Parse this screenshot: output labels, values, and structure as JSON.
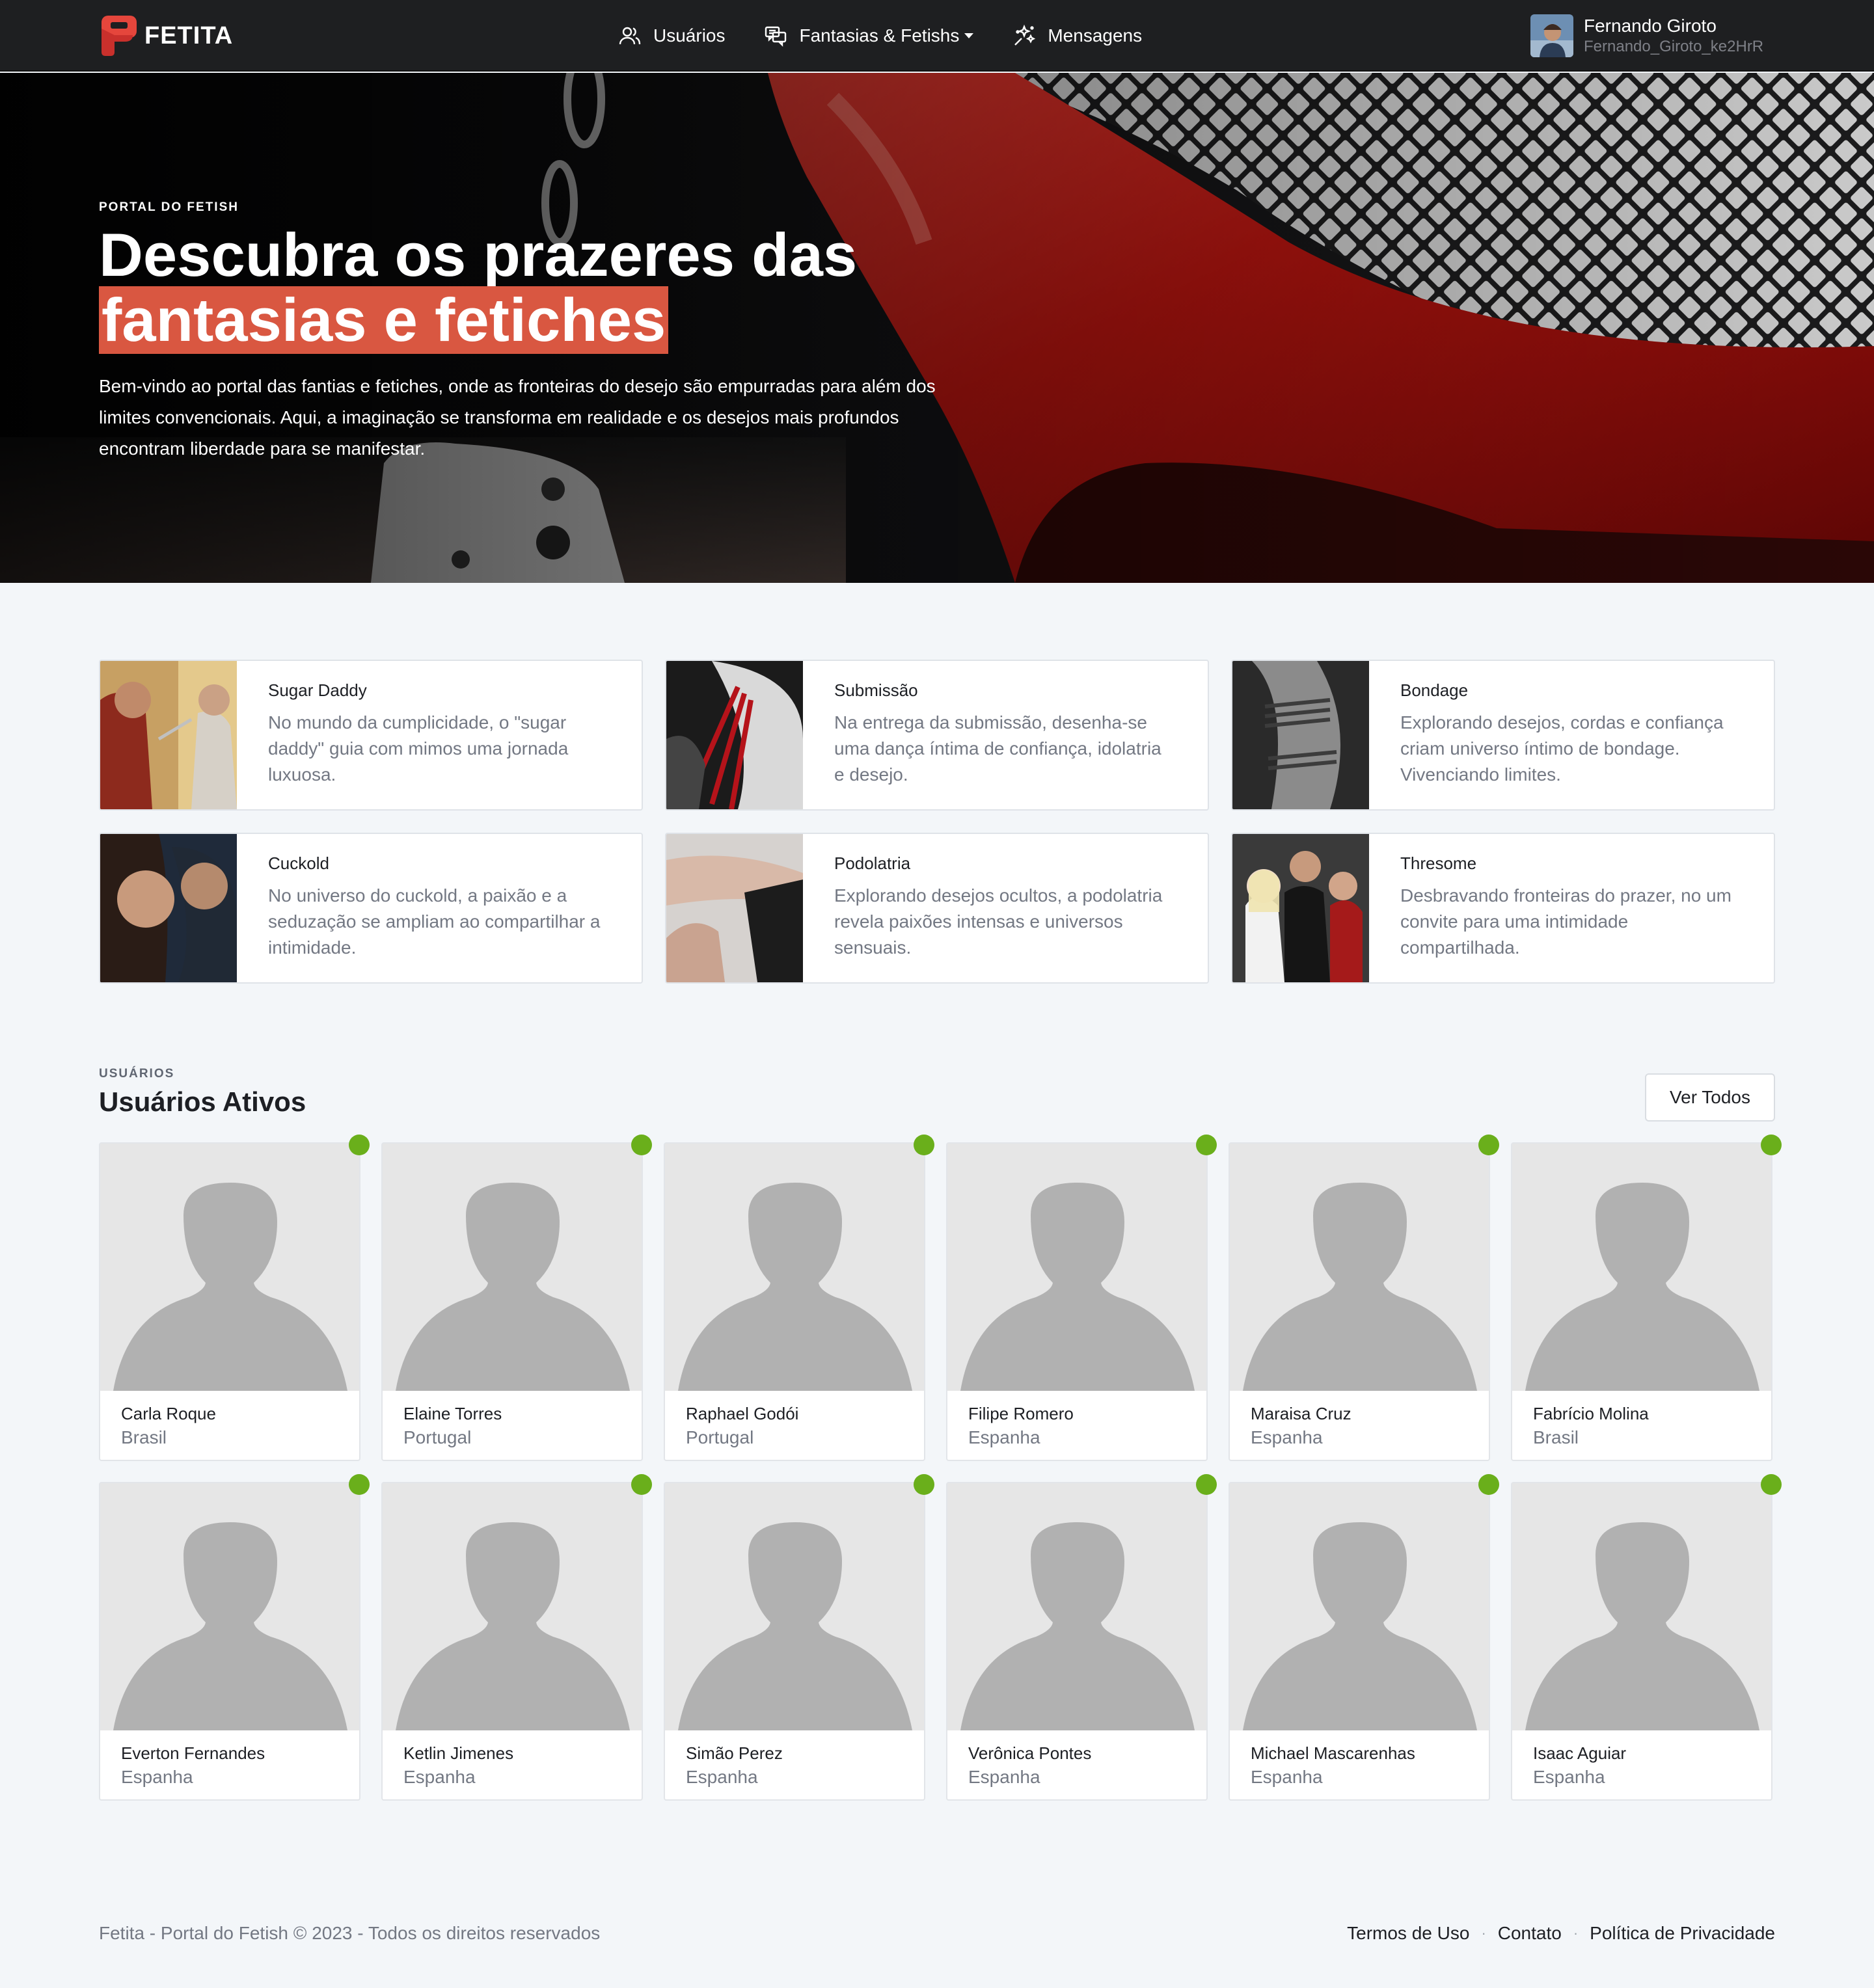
{
  "navbar": {
    "brand": "FETITA",
    "menu": [
      {
        "label": "Usuários",
        "icon": "users-icon"
      },
      {
        "label": "Fantasias & Fetishs",
        "icon": "chat-bubbles-icon"
      },
      {
        "label": "Mensagens",
        "icon": "sparkles-icon"
      }
    ],
    "user": {
      "name": "Fernando Giroto",
      "handle": "Fernando_Giroto_ke2HrR"
    }
  },
  "hero": {
    "eyebrow": "PORTAL DO FETISH",
    "title_line1": "Descubra os prazeres das",
    "title_highlight": "fantasias e fetiches",
    "text": "Bem-vindo ao portal das fantias e fetiches, onde as fronteiras do desejo são empurradas para além dos limites convencionais. Aqui, a imaginação se transforma em realidade e os desejos mais profundos encontram liberdade para se manifestar."
  },
  "categories": [
    {
      "title": "Sugar Daddy",
      "desc": "No mundo da cumplicidade, o \"sugar daddy\" guia com mimos uma jornada luxuosa."
    },
    {
      "title": "Submissão",
      "desc": "Na entrega da submissão, desenha-se uma dança íntima de confiança, idolatria e desejo."
    },
    {
      "title": "Bondage",
      "desc": "Explorando desejos, cordas e confiança criam universo íntimo de bondage. Vivenciando limites."
    },
    {
      "title": "Cuckold",
      "desc": "No universo do cuckold, a paixão e a seduzação se ampliam ao compartilhar a intimidade."
    },
    {
      "title": "Podolatria",
      "desc": "Explorando desejos ocultos, a podolatria revela paixões intensas e universos sensuais."
    },
    {
      "title": "Thresome",
      "desc": "Desbravando fronteiras do prazer, no um convite para uma intimidade compartilhada."
    }
  ],
  "users_section": {
    "eyebrow": "USUÁRIOS",
    "title": "Usuários Ativos",
    "button": "Ver Todos",
    "online_color": "#6aaf1b",
    "users": [
      {
        "name": "Carla Roque",
        "country": "Brasil"
      },
      {
        "name": "Elaine Torres",
        "country": "Portugal"
      },
      {
        "name": "Raphael Godói",
        "country": "Portugal"
      },
      {
        "name": "Filipe Romero",
        "country": "Espanha"
      },
      {
        "name": "Maraisa Cruz",
        "country": "Espanha"
      },
      {
        "name": "Fabrício Molina",
        "country": "Brasil"
      },
      {
        "name": "Everton Fernandes",
        "country": "Espanha"
      },
      {
        "name": "Ketlin Jimenes",
        "country": "Espanha"
      },
      {
        "name": "Simão Perez",
        "country": "Espanha"
      },
      {
        "name": "Verônica Pontes",
        "country": "Espanha"
      },
      {
        "name": "Michael Mascarenhas",
        "country": "Espanha"
      },
      {
        "name": "Isaac Aguiar",
        "country": "Espanha"
      }
    ]
  },
  "footer": {
    "copyright": "Fetita - Portal do Fetish © 2023 - Todos os direitos reservados",
    "links": [
      "Termos de Uso",
      "Contato",
      "Política de Privacidade"
    ]
  },
  "colors": {
    "accent": "#d95741",
    "brand": "#e5463c",
    "navbar": "#1e1f21",
    "background": "#f3f6f9"
  }
}
